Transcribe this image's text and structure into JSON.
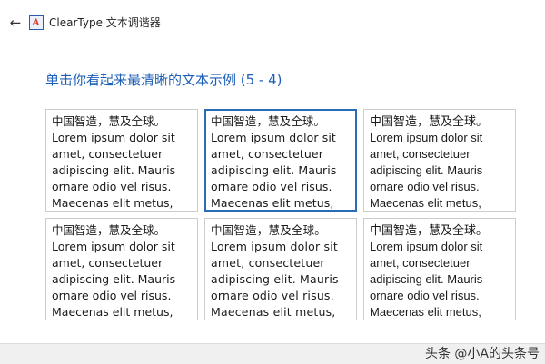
{
  "window": {
    "back_icon": "back-arrow-icon",
    "app_icon": "cleartype-icon",
    "title": "ClearType 文本调谐器"
  },
  "page": {
    "heading": "单击你看起来最清晰的文本示例 (5 - 4)"
  },
  "samples": [
    {
      "cn": "中国智造，慧及全球。",
      "lines": [
        "Lorem ipsum dolor sit",
        "amet, consectetuer",
        "adipiscing elit. Mauris",
        "ornare odio vel risus.",
        "Maecenas elit metus,"
      ],
      "selected": false
    },
    {
      "cn": "中国智造，慧及全球。",
      "lines": [
        "Lorem ipsum dolor sit",
        "amet, consectetuer",
        "adipiscing elit. Mauris",
        "ornare odio vel risus.",
        "Maecenas elit metus,"
      ],
      "selected": true
    },
    {
      "cn": "中国智造，慧及全球。",
      "lines": [
        "Lorem ipsum dolor sit",
        "amet, consectetuer",
        "adipiscing elit. Mauris",
        "ornare odio vel risus.",
        "Maecenas elit metus,"
      ],
      "selected": false
    },
    {
      "cn": "中国智造，慧及全球。",
      "lines": [
        "Lorem ipsum dolor sit",
        "amet, consectetuer",
        "adipiscing elit. Mauris",
        "ornare odio vel risus.",
        "Maecenas elit metus,"
      ],
      "selected": false
    },
    {
      "cn": "中国智造，慧及全球。",
      "lines": [
        "Lorem ipsum dolor sit",
        "amet, consectetuer",
        "adipiscing elit. Mauris",
        "ornare odio vel risus.",
        "Maecenas elit metus,"
      ],
      "selected": false
    },
    {
      "cn": "中国智造，慧及全球。",
      "lines": [
        "Lorem ipsum dolor sit",
        "amet, consectetuer",
        "adipiscing elit. Mauris",
        "ornare odio vel risus.",
        "Maecenas elit metus,"
      ],
      "selected": false
    }
  ],
  "watermark": "头条 @小A的头条号",
  "colors": {
    "accent": "#2b6cb8",
    "heading": "#1d5fb7",
    "border": "#cdcdcd"
  }
}
